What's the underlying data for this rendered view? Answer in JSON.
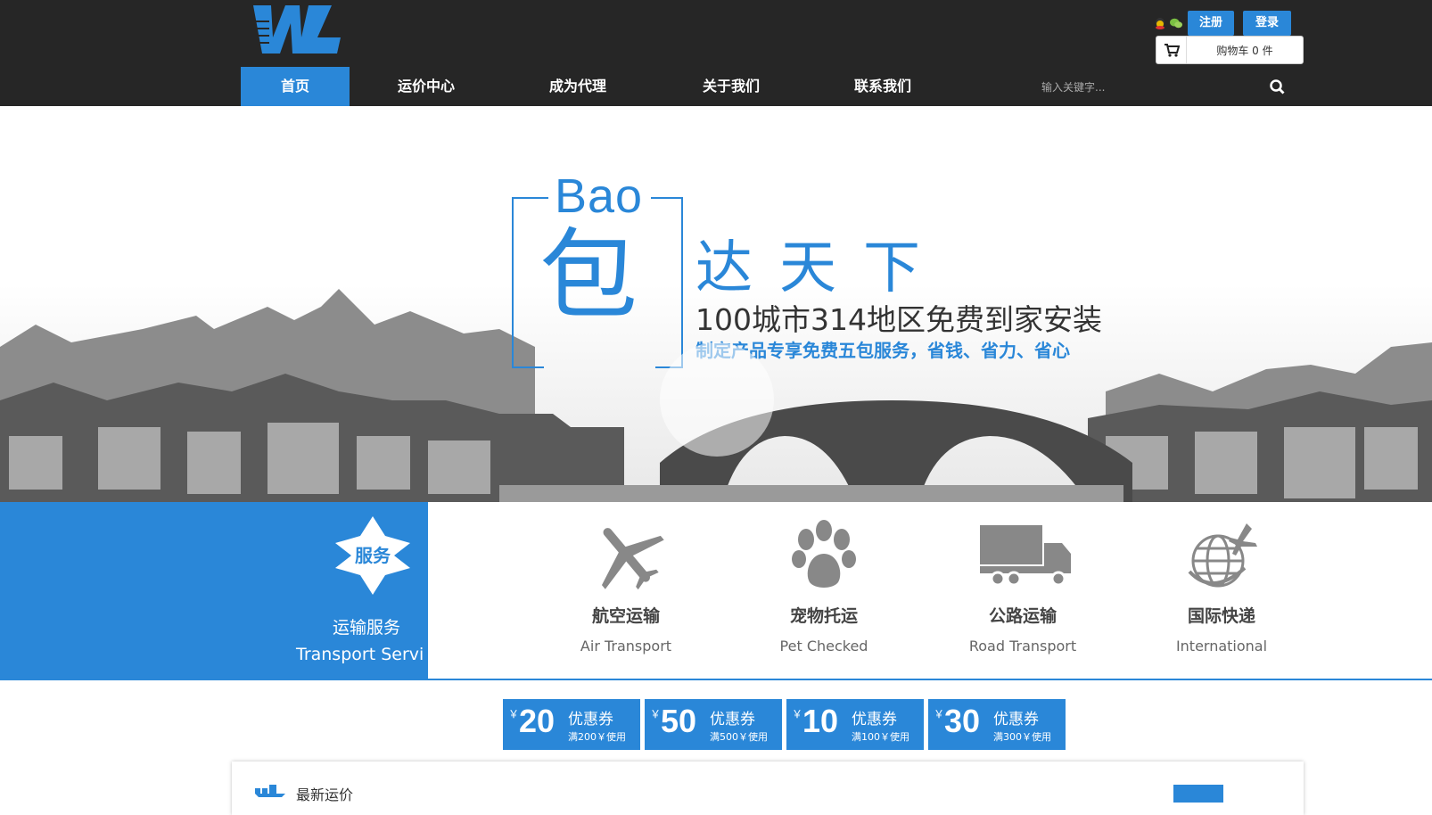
{
  "header": {
    "logo_text": "WL",
    "nav": [
      {
        "label": "首页",
        "active": true
      },
      {
        "label": "运价中心",
        "active": false
      },
      {
        "label": "成为代理",
        "active": false
      },
      {
        "label": "关于我们",
        "active": false
      },
      {
        "label": "联系我们",
        "active": false
      }
    ],
    "register_label": "注册",
    "login_label": "登录",
    "cart_text": "购物车 0 件",
    "search_placeholder": "输入关键字..."
  },
  "banner": {
    "bao_word": "Bao",
    "bao_char": "包",
    "tagline_main": "达天下",
    "tagline_sub": "100城市314地区免费到家安装",
    "tagline_note": "制定产品专享免费五包服务，省钱、省力、省心"
  },
  "services": {
    "badge": "服务",
    "title": "运输服务",
    "subtitle": "Transport Servi",
    "items": [
      {
        "cn": "航空运输",
        "en": "Air Transport",
        "icon": "airplane-icon"
      },
      {
        "cn": "宠物托运",
        "en": "Pet Checked",
        "icon": "paw-icon"
      },
      {
        "cn": "公路运输",
        "en": "Road Transport",
        "icon": "truck-icon"
      },
      {
        "cn": "国际快递",
        "en": "International",
        "icon": "globe-plane-icon"
      }
    ]
  },
  "coupons": [
    {
      "yen": "￥",
      "amount": "20",
      "label": "优惠券",
      "condition": "满200￥使用"
    },
    {
      "yen": "￥",
      "amount": "50",
      "label": "优惠券",
      "condition": "满500￥使用"
    },
    {
      "yen": "￥",
      "amount": "10",
      "label": "优惠券",
      "condition": "满100￥使用"
    },
    {
      "yen": "￥",
      "amount": "30",
      "label": "优惠券",
      "condition": "满300￥使用"
    }
  ],
  "news": {
    "title": "最新运价"
  },
  "colors": {
    "accent": "#2a87d8",
    "header_bg": "#262626"
  }
}
